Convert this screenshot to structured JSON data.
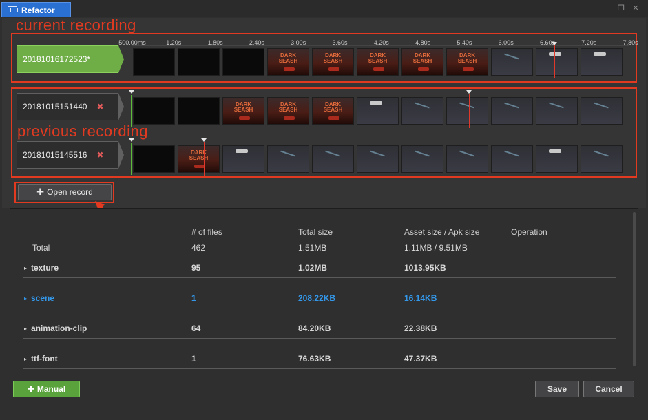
{
  "window": {
    "tab_title": "Refactor",
    "restore_icon": "restore-window-icon",
    "close_icon": "close-window-icon"
  },
  "annotations": {
    "current": "current recording",
    "previous": "previous recording"
  },
  "ruler": {
    "labels": [
      "500.00ms",
      "1.20s",
      "1.80s",
      "2.40s",
      "3.00s",
      "3.60s",
      "4.20s",
      "4.80s",
      "5.40s",
      "6.00s",
      "6.60s",
      "7.20s",
      "7.80s"
    ]
  },
  "recordings": [
    {
      "id": "20181016172523*",
      "active": true,
      "removable": false
    },
    {
      "id": "20181015151440",
      "active": false,
      "removable": true,
      "remove_glyph": "✖"
    },
    {
      "id": "20181015145516",
      "active": false,
      "removable": true,
      "remove_glyph": "✖"
    }
  ],
  "open_record": {
    "plus": "✚",
    "label": "Open record"
  },
  "table": {
    "headers": {
      "files": "# of files",
      "total": "Total size",
      "asset": "Asset size / Apk size",
      "operation": "Operation"
    },
    "total_row": {
      "name": "Total",
      "files": "462",
      "total": "1.51MB",
      "asset": "1.11MB / 9.51MB"
    },
    "rows": [
      {
        "name": "texture",
        "files": "95",
        "total": "1.02MB",
        "asset": "1013.95KB",
        "highlight": false
      },
      {
        "name": "scene",
        "files": "1",
        "total": "208.22KB",
        "asset": "16.14KB",
        "highlight": true
      },
      {
        "name": "animation-clip",
        "files": "64",
        "total": "84.20KB",
        "asset": "22.38KB",
        "highlight": false
      },
      {
        "name": "ttf-font",
        "files": "1",
        "total": "76.63KB",
        "asset": "47.37KB",
        "highlight": false
      }
    ],
    "expand_glyph": "▸"
  },
  "footer": {
    "manual_plus": "✚",
    "manual_label": "Manual",
    "save_label": "Save",
    "cancel_label": "Cancel"
  },
  "colors": {
    "accent_red": "#e23a20",
    "active_green": "#6fae47",
    "highlight_blue": "#3398ea",
    "tab_blue": "#2a6fd2"
  }
}
